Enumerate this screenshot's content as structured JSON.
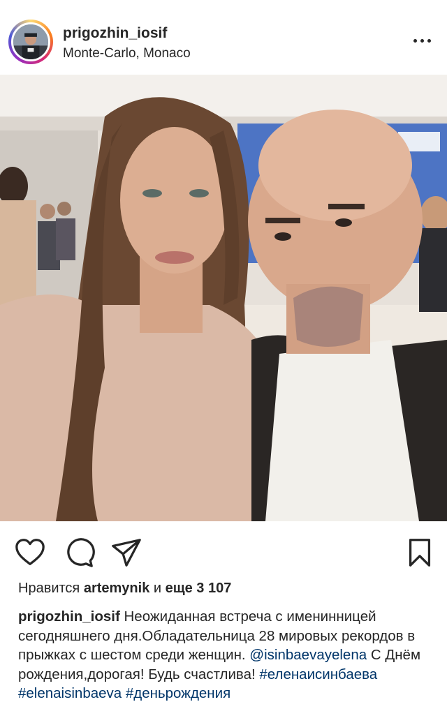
{
  "post": {
    "username": "prigozhin_iosif",
    "location": "Monte-Carlo, Monaco",
    "more_icon": "more-horizontal-icon"
  },
  "photo": {
    "description_icon": "photo",
    "colors": {
      "wall": "#e9e3dc",
      "ceiling": "#f4f1ed",
      "blue_wall": "#4a73c8",
      "dress": "#d9b6a3",
      "jacket": "#2a2624",
      "shirt": "#f3f1ec",
      "skin": "#d9a98d",
      "hair": "#6b4a34"
    }
  },
  "actions": {
    "like_icon": "heart-icon",
    "comment_icon": "comment-icon",
    "share_icon": "paper-plane-icon",
    "save_icon": "bookmark-icon"
  },
  "likes": {
    "prefix": "Нравится",
    "user": "artemynik",
    "middle": "и",
    "more": "еще 3 107"
  },
  "caption": {
    "username": "prigozhin_iosif",
    "text_1": "Неожиданная встреча с именинницей сегодняшнего дня.Обладательница 28 мировых рекордов в прыжках с шестом среди женщин.",
    "mention": "@isinbaevayelena",
    "text_2": "С Днём рождения,дорогая! Будь счастлива!",
    "hashtag_1": "#еленаисинбаева",
    "hashtag_2": "#elenaisinbaeva",
    "hashtag_3": "#деньрождения"
  },
  "colors": {
    "text": "#262626",
    "link": "#003569",
    "background": "#ffffff"
  }
}
